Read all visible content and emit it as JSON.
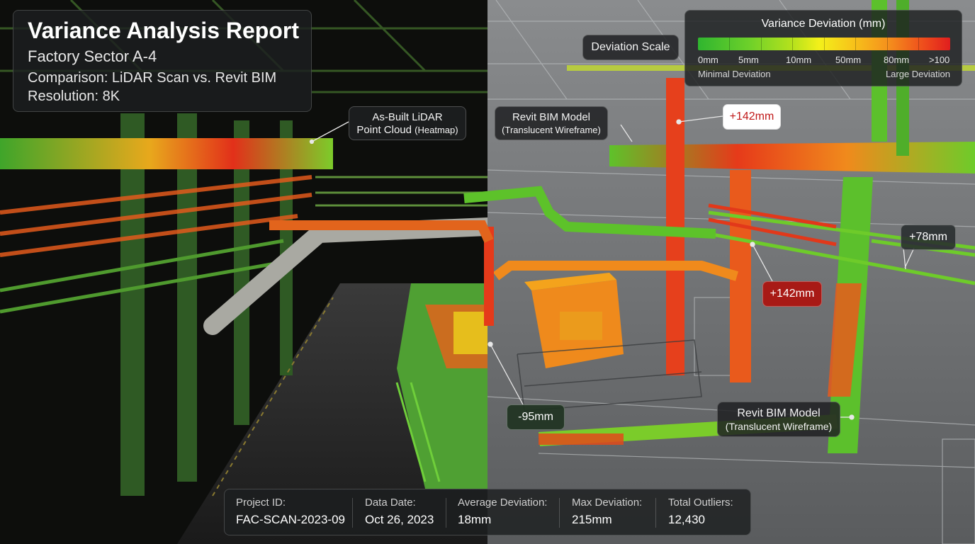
{
  "header": {
    "title": "Variance Analysis Report",
    "sector": "Factory Sector A-4",
    "comparison": "Comparison: LiDAR Scan vs. Revit BIM",
    "resolution": "Resolution: 8K"
  },
  "scale": {
    "chip_label": "Deviation Scale",
    "title": "Variance Deviation (mm)",
    "ticks": [
      "0mm",
      "5mm",
      "10mm",
      "50mm",
      "80mm",
      ">100"
    ],
    "min_label": "Minimal Deviation",
    "max_label": "Large Deviation",
    "colors": [
      "#2fb52f",
      "#6cd02a",
      "#b8e21c",
      "#f3f01a",
      "#f7c81a",
      "#f5921c",
      "#ee4a1c",
      "#e01e1e"
    ]
  },
  "labels": {
    "lidar_line1": "As-Built LiDAR",
    "lidar_line2": "Point Cloud",
    "lidar_line2_suffix": "(Heatmap)",
    "bim_top_line1": "Revit BIM Model",
    "bim_top_line2": "(Translucent Wireframe)",
    "bim_bottom_line1": "Revit BIM Model",
    "bim_bottom_line2": "(Translucent Wireframe)"
  },
  "callouts": {
    "top": "+142mm",
    "middle": "+142mm",
    "right": "+78mm",
    "bottom": "-95mm"
  },
  "stats": {
    "project_id_label": "Project ID:",
    "project_id": "FAC-SCAN-2023-09",
    "data_date_label": "Data Date:",
    "data_date": "Oct 26, 2023",
    "avg_dev_label": "Average Deviation:",
    "avg_dev": "18mm",
    "max_dev_label": "Max Deviation:",
    "max_dev": "215mm",
    "outliers_label": "Total Outliers:",
    "outliers": "12,430"
  }
}
